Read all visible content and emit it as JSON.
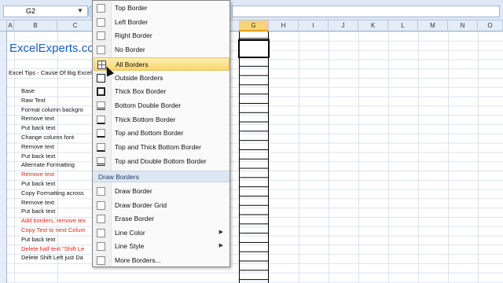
{
  "namebox": {
    "value": "G2"
  },
  "columns": {
    "left": [
      {
        "label": "A",
        "id": "a"
      },
      {
        "label": "B",
        "id": "b"
      },
      {
        "label": "C",
        "id": "c"
      }
    ],
    "right": [
      {
        "label": "G",
        "id": "g"
      },
      {
        "label": "H",
        "id": "h"
      },
      {
        "label": "I",
        "id": "i"
      },
      {
        "label": "J",
        "id": "j"
      },
      {
        "label": "K",
        "id": "k"
      },
      {
        "label": "L",
        "id": "l"
      },
      {
        "label": "M",
        "id": "m"
      },
      {
        "label": "N",
        "id": "n"
      },
      {
        "label": "O",
        "id": "o"
      }
    ]
  },
  "sheet": {
    "title": "ExcelExperts.co",
    "subtitle": "Excel Tips - Cause Of Big Excel",
    "rows": [
      {
        "text": "Base",
        "color": "#111111"
      },
      {
        "text": "Raw Text",
        "color": "#111111"
      },
      {
        "text": "Format column backgro",
        "color": "#111111"
      },
      {
        "text": "Remove text",
        "color": "#111111"
      },
      {
        "text": "Put back text",
        "color": "#111111"
      },
      {
        "text": "Change column font",
        "color": "#111111"
      },
      {
        "text": "Remove text",
        "color": "#111111"
      },
      {
        "text": "Put back text",
        "color": "#111111"
      },
      {
        "text": "Alternate Formatting",
        "color": "#111111"
      },
      {
        "text": "Remove text",
        "color": "#e0241b"
      },
      {
        "text": "Put back text",
        "color": "#111111"
      },
      {
        "text": "Copy Formatting across",
        "color": "#111111"
      },
      {
        "text": "Remove text",
        "color": "#111111"
      },
      {
        "text": "Put back text",
        "color": "#111111"
      },
      {
        "text": "Add borders, remove tex",
        "color": "#e0241b"
      },
      {
        "text": "Copy Text to next Colum",
        "color": "#e0241b"
      },
      {
        "text": "Put back text",
        "color": "#111111"
      },
      {
        "text": "Delete half text \"Shift Le",
        "color": "#e0241b"
      },
      {
        "text": "Delete Shift Left just Da",
        "color": "#111111"
      }
    ]
  },
  "menu": {
    "items": [
      {
        "label": "Top Border",
        "icon": "top-border-icon",
        "y": 0
      },
      {
        "label": "Left Border",
        "icon": "left-border-icon",
        "y": 0
      },
      {
        "label": "Right Border",
        "icon": "right-border-icon",
        "y": 0
      },
      {
        "label": "No Border",
        "icon": "no-border-icon",
        "y": 0
      },
      {
        "label": "All Borders",
        "icon": "all-borders-icon",
        "y": 0
      },
      {
        "label": "Outside Borders",
        "icon": "outside-borders-icon",
        "y": 0
      },
      {
        "label": "Thick Box Border",
        "icon": "thick-box-border-icon",
        "y": 0
      },
      {
        "label": "Bottom Double Border",
        "icon": "bottom-double-border-icon",
        "y": 0
      },
      {
        "label": "Thick Bottom Border",
        "icon": "thick-bottom-border-icon",
        "y": 0
      },
      {
        "label": "Top and Bottom Border",
        "icon": "top-bottom-border-icon",
        "y": 0
      },
      {
        "label": "Top and Thick Bottom Border",
        "icon": "top-thick-bottom-border-icon",
        "y": 0
      },
      {
        "label": "Top and Double Bottom Border",
        "icon": "top-double-bottom-border-icon",
        "y": 0
      }
    ],
    "section_label": "Draw Borders",
    "draw_items": [
      {
        "label": "Draw Border",
        "icon": "draw-border-icon"
      },
      {
        "label": "Draw Border Grid",
        "icon": "draw-border-grid-icon"
      },
      {
        "label": "Erase Border",
        "icon": "eraser-icon"
      },
      {
        "label": "Line Color",
        "icon": "line-color-icon",
        "submenu": true
      },
      {
        "label": "Line Style",
        "icon": "line-style-icon",
        "submenu": true
      },
      {
        "label": "More Borders...",
        "icon": "more-borders-icon"
      }
    ],
    "highlighted": "All Borders"
  }
}
